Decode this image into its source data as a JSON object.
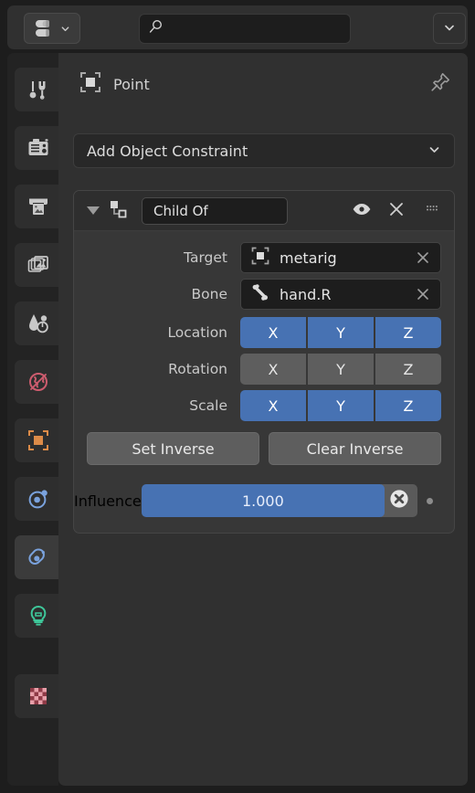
{
  "topbar": {
    "editor_type_icon": "properties-editor-icon",
    "editor_type_chevron": "chevron-down-icon",
    "search": {
      "value": "",
      "placeholder": "",
      "icon": "search-icon"
    },
    "filter_icon": "chevron-down-icon"
  },
  "tabs": [
    {
      "name": "tool",
      "icon": "tool-icon",
      "active": false
    },
    {
      "name": "render",
      "icon": "camera-back-icon",
      "active": false
    },
    {
      "name": "output",
      "icon": "printer-icon",
      "active": false
    },
    {
      "name": "view-layer",
      "icon": "images-icon",
      "active": false
    },
    {
      "name": "scene",
      "icon": "scene-cone-icon",
      "active": false
    },
    {
      "name": "world",
      "icon": "world-globe-icon",
      "active": false
    },
    {
      "name": "object",
      "icon": "object-square-icon",
      "active": false
    },
    {
      "name": "physics",
      "icon": "physics-orbit-icon",
      "active": false
    },
    {
      "name": "constraints",
      "icon": "constraint-icon",
      "active": true
    },
    {
      "name": "data-light",
      "icon": "light-bulb-icon",
      "active": false
    },
    {
      "name": "material",
      "icon": "checker-icon",
      "active": false
    }
  ],
  "header": {
    "object_icon": "object-square-icon",
    "title": "Point",
    "pin_icon": "pin-icon"
  },
  "add_constraint": {
    "label": "Add Object Constraint",
    "chevron": "chevron-down-icon"
  },
  "constraint": {
    "expand_icon": "triangle-down-icon",
    "type_icon": "constraint-child-of-icon",
    "name": "Child Of",
    "visibility_icon": "eye-icon",
    "delete_icon": "close-x-icon",
    "grip_icon": "grip-dots-icon",
    "fields": [
      {
        "label": "Target",
        "icon": "object-square-icon",
        "value": "metarig",
        "clear_icon": "close-x-icon"
      },
      {
        "label": "Bone",
        "icon": "bone-icon",
        "value": "hand.R",
        "clear_icon": "close-x-icon"
      }
    ],
    "toggles": [
      {
        "label": "Location",
        "axes": [
          "X",
          "Y",
          "Z"
        ],
        "states": [
          true,
          true,
          true
        ]
      },
      {
        "label": "Rotation",
        "axes": [
          "X",
          "Y",
          "Z"
        ],
        "states": [
          false,
          false,
          false
        ]
      },
      {
        "label": "Scale",
        "axes": [
          "X",
          "Y",
          "Z"
        ],
        "states": [
          true,
          true,
          true
        ]
      }
    ],
    "buttons": [
      {
        "label": "Set Inverse"
      },
      {
        "label": "Clear Inverse"
      }
    ],
    "influence": {
      "label": "Influence",
      "value": "1.000",
      "fill_percent": 100,
      "animate_icon": "x-circle-icon",
      "decorator_icon": "decorator-dot-icon"
    }
  },
  "colors": {
    "accent_blue": "#4772b3",
    "panel_bg": "#303030",
    "card_bg": "#373737",
    "field_bg": "#1d1d1d",
    "toggle_off": "#5e5e5e",
    "world_red": "#cd5c6e",
    "object_orange": "#dc8b48",
    "physics_blue": "#7aa2dd",
    "light_green": "#3ec79a",
    "material_pink": "#e08090"
  }
}
